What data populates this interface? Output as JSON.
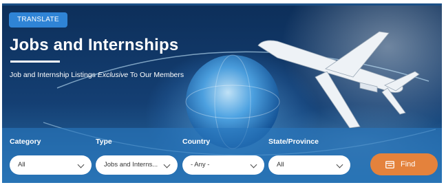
{
  "translate_label": "TRANSLATE",
  "title": "Jobs and Internships",
  "subtitle_prefix": "Job and Internship Listings ",
  "subtitle_emphasis": "Exclusive",
  "subtitle_suffix": " To Our Members",
  "filters": [
    {
      "label": "Category",
      "value": "All"
    },
    {
      "label": "Type",
      "value": "Jobs and Interns..."
    },
    {
      "label": "Country",
      "value": "- Any -"
    },
    {
      "label": "State/Province",
      "value": "All"
    }
  ],
  "find_label": "Find",
  "colors": {
    "hero_dark": "#0d2f5a",
    "translate_bg": "#2f84d6",
    "find_bg": "#e4823c",
    "filter_bar": "#2878be"
  },
  "icons": {
    "find": "calendar-icon",
    "select": "chevron-down-icon"
  }
}
